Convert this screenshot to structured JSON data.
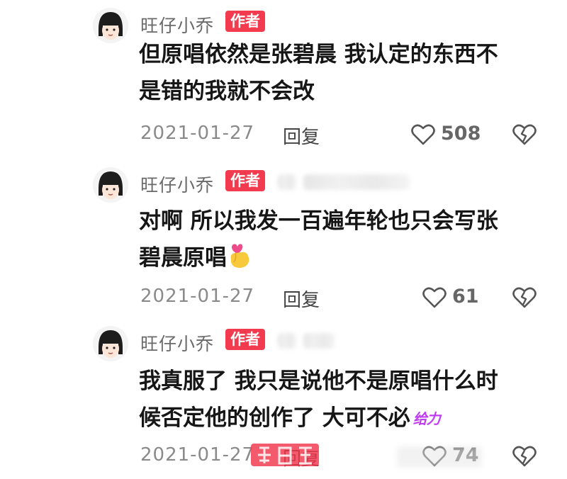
{
  "comments": [
    {
      "username": "旺仔小乔",
      "badge": "作者",
      "body_lines": [
        "但原唱依然是张碧晨 我认定的东西不",
        "是错的我就不会改"
      ],
      "date": "2021-01-27",
      "reply_label": "回复",
      "like_count": "508"
    },
    {
      "username": "旺仔小乔",
      "badge": "作者",
      "body_lines": [
        "对啊 所以我发一百遍年轮也只会写张",
        "碧晨原唱"
      ],
      "date": "2021-01-27",
      "reply_label": "回复",
      "like_count": "61"
    },
    {
      "username": "旺仔小乔",
      "badge": "作者",
      "body_lines": [
        "我真服了 我只是说他不是原唱什么时",
        "候否定他的创作了 大可不必"
      ],
      "sticker_text": "给力",
      "date": "2021-01-27",
      "reply_label": "回复",
      "like_count": "74"
    }
  ],
  "colors": {
    "badge": "#f23b4e",
    "username": "#6a6a6a",
    "date": "#8a8a8a",
    "sticker": "#c03cf0"
  },
  "icons": [
    "avatar-icon",
    "heart-outline-icon",
    "broken-heart-icon",
    "finger-heart-emoji-icon",
    "watermark-logo-icon"
  ]
}
